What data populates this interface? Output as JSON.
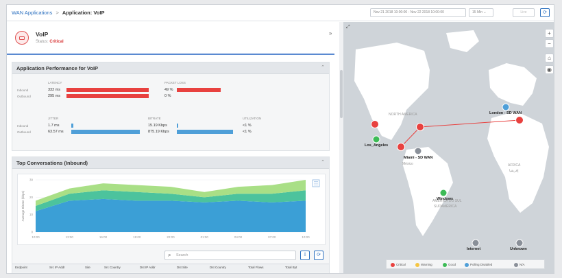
{
  "breadcrumb": {
    "parent": "WAN Applications",
    "separator": ">",
    "current": "Application: VoIP"
  },
  "toolbar": {
    "range_start": "Nov 21 2018 10:00:00",
    "range_sep": "-",
    "range_end": "Nov 22 2018 10:00:00",
    "interval": "15 Min",
    "interval_chevron": "⌄",
    "live_label": "Live",
    "refresh_icon": "⟳"
  },
  "app": {
    "name": "VoIP",
    "status_label": "Status:",
    "status_value": "Critical"
  },
  "left_collapse": "»",
  "performance": {
    "title": "Application Performance for VoIP",
    "row_labels": [
      "Inbound",
      "Outbound"
    ],
    "col_latency": "LATENCY",
    "col_packet_loss": "PACKET LOSS",
    "col_jitter": "JITTER",
    "col_bitrate": "BITRATE",
    "col_utilization": "UTILIZATION",
    "latency": [
      "332 ms",
      "295 ms"
    ],
    "packet_loss": [
      "49 %",
      "0 %"
    ],
    "jitter": [
      "1.7 ms",
      "63.57 ms"
    ],
    "bitrate": [
      "15.19 Kbps",
      "875.19 Kbps"
    ],
    "utilization": [
      "<1 %",
      "<1 %"
    ],
    "latency_frac": [
      1.0,
      1.0
    ],
    "packet_loss_frac": [
      0.78,
      0
    ],
    "jitter_frac": [
      0.03,
      1.0
    ],
    "bitrate_frac": [
      0.02,
      1.0
    ],
    "colors": {
      "critical": "#e8413f",
      "normal": "#4f9fd8"
    }
  },
  "conversations": {
    "title": "Top Conversations (Inbound)",
    "ylabel": "Average Bitrate (kbps)",
    "search_placeholder": "Search",
    "columns": [
      "Endpoint",
      "Src IP Addr",
      "Site",
      "Src Country",
      "Dst IP Addr",
      "Dst Site",
      "Dst Country",
      "Total Flows",
      "Total Byt"
    ]
  },
  "chart_data": {
    "type": "area",
    "x": [
      "10:00",
      "13:00",
      "16:00",
      "19:00",
      "22:00",
      "01:00",
      "04:00",
      "07:00",
      "10:00"
    ],
    "tick_labels": [
      "10:00",
      "13:00",
      "16:00",
      "19:00",
      "22:00",
      "01:00",
      "04:00",
      "07:00",
      "10:00"
    ],
    "yticks": [
      "30",
      "20",
      "10",
      "0"
    ],
    "ylim": [
      0,
      30
    ],
    "stacked": true,
    "series": [
      {
        "color": "#3b9fd6",
        "values": [
          12,
          18,
          19,
          18,
          18,
          17,
          18,
          17,
          18
        ]
      },
      {
        "color": "#4cc39d",
        "values": [
          3,
          4,
          5,
          5,
          4,
          3,
          4,
          5,
          6
        ]
      },
      {
        "color": "#a9df86",
        "values": [
          3,
          3,
          4,
          4,
          4,
          3,
          4,
          5,
          6
        ]
      }
    ]
  },
  "map": {
    "expand_icon": "⤢",
    "zoom_in": "+",
    "zoom_out": "−",
    "home_icon": "⌂",
    "locate_icon": "◉",
    "labels": {
      "north_america": "NORTH AMERICA",
      "south_america": "SOUTH AMERICA",
      "africa": "AFRICA",
      "africa_native": "إفريقيا",
      "mexico": "México",
      "south_america_pt": "AMÉRICA DO SUL",
      "south_america_es": "SUDAMÉRICA"
    },
    "sites": {
      "london": "London - SD WAN",
      "los_angeles": "Los_Angeles",
      "miami": "Miami - SD WAN",
      "windows": "Windows",
      "internet": "Internet",
      "unknown": "Unknown"
    },
    "legend": [
      {
        "label": "Critical",
        "color": "#e8413f"
      },
      {
        "label": "Warning",
        "color": "#f5c542"
      },
      {
        "label": "Good",
        "color": "#3dbb56"
      },
      {
        "label": "Polling Disabled",
        "color": "#4f9fd8"
      },
      {
        "label": "N/A",
        "color": "#8a9099"
      }
    ]
  }
}
